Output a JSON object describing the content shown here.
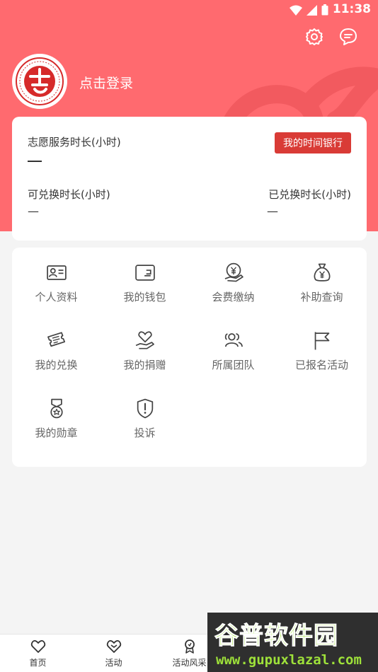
{
  "status_bar": {
    "time": "11:38"
  },
  "header": {
    "login_text": "点击登录"
  },
  "stats": {
    "title": "志愿服务时长(小时)",
    "time_bank_button": "我的时间银行",
    "exchangeable_label": "可兑换时长(小时)",
    "exchanged_label": "已兑换时长(小时)",
    "exchangeable_value": "—",
    "exchanged_value": "—"
  },
  "menu": [
    {
      "label": "个人资料",
      "icon": "id-card-icon"
    },
    {
      "label": "我的钱包",
      "icon": "wallet-icon"
    },
    {
      "label": "会费缴纳",
      "icon": "yen-coin-hand-icon"
    },
    {
      "label": "补助查询",
      "icon": "money-bag-icon"
    },
    {
      "label": "我的兑换",
      "icon": "ticket-icon"
    },
    {
      "label": "我的捐赠",
      "icon": "heart-hand-icon"
    },
    {
      "label": "所属团队",
      "icon": "team-icon"
    },
    {
      "label": "已报名活动",
      "icon": "flag-icon"
    },
    {
      "label": "我的勋章",
      "icon": "medal-icon"
    },
    {
      "label": "投诉",
      "icon": "shield-alert-icon"
    }
  ],
  "bottom_nav": [
    {
      "label": "首页"
    },
    {
      "label": "活动"
    },
    {
      "label": "活动风采"
    }
  ],
  "watermark": {
    "brand": "谷普软件园",
    "url": "www.gupuxlazal.com"
  },
  "colors": {
    "header": "#ff6a6f",
    "accent": "#d93b36"
  }
}
